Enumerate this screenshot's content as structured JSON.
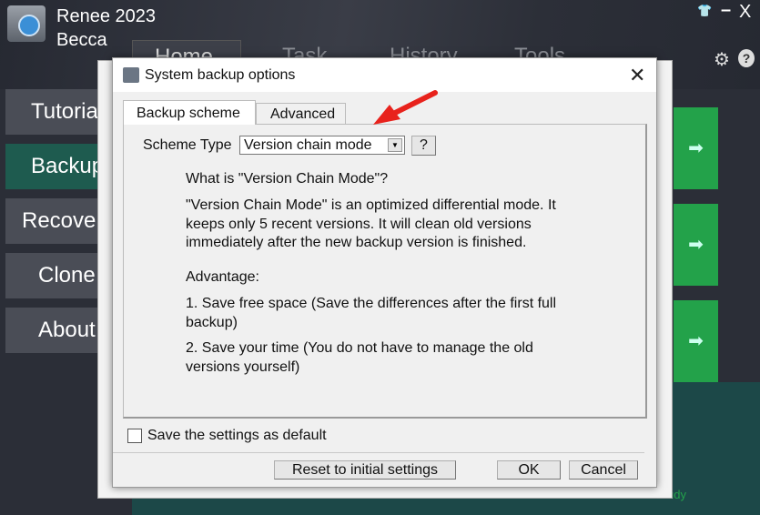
{
  "app": {
    "brand_line1": "Renee 2023",
    "brand_line2": "Becca",
    "fast_study": "Fast study"
  },
  "main_tabs": [
    "Home",
    "Task",
    "History",
    "Tools"
  ],
  "sidebar": [
    "Tutorial",
    "Backup",
    "Recover",
    "Clone",
    "About"
  ],
  "colors": {
    "accent_green": "#23a24a",
    "selected_sidebar": "#1e5b4f",
    "arrow": "#e8221c"
  },
  "dialog": {
    "title": "System backup options",
    "tabs": [
      "Backup scheme",
      "Advanced"
    ],
    "scheme_label": "Scheme Type",
    "scheme_value": "Version chain mode",
    "help_button": "?",
    "heading": "What is \"Version Chain Mode\"?",
    "description": "\"Version Chain Mode\" is an optimized differential mode. It keeps only 5 recent versions. It will clean old versions immediately after the new backup version is finished.",
    "advantage_label": "Advantage:",
    "advantage_1": "1. Save free space (Save the differences after the first full backup)",
    "advantage_2": "2. Save your time (You do not have to manage the old versions yourself)",
    "checkbox_label": "Save the settings as default",
    "checkbox_checked": false,
    "reset_button": "Reset to initial settings",
    "ok_button": "OK",
    "cancel_button": "Cancel"
  }
}
